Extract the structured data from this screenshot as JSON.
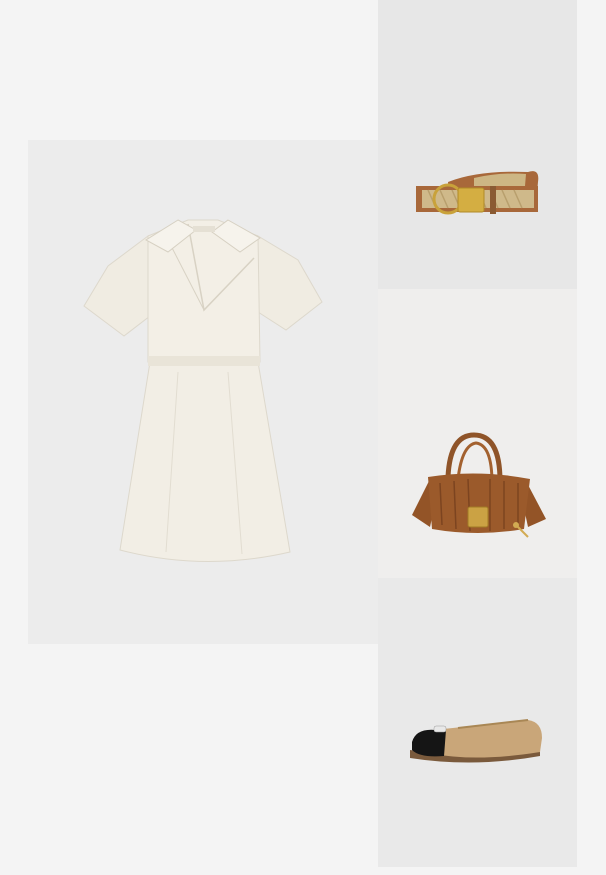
{
  "outfit": {
    "items": [
      {
        "id": "dress",
        "icon": "dress-image",
        "background": "#ececec",
        "color": "#f1ede3"
      },
      {
        "id": "belt",
        "icon": "belt-image",
        "background": "#e7e7e7",
        "color": "#a8683a"
      },
      {
        "id": "bag",
        "icon": "handbag-image",
        "background": "#efeeed",
        "color": "#96572a"
      },
      {
        "id": "shoes",
        "icon": "ballet-flat-image",
        "background": "#e9e9e9",
        "color": "#c9a679"
      }
    ]
  }
}
